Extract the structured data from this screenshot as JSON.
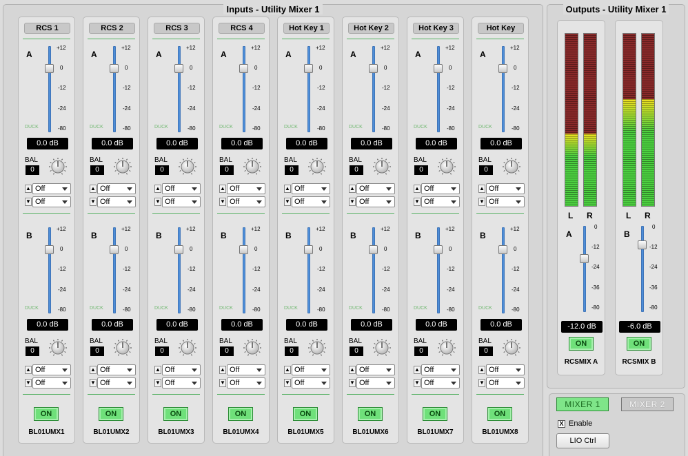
{
  "inputs_title": "Inputs - Utility Mixer 1",
  "outputs_title": "Outputs - Utility Mixer 1",
  "fader_ticks": [
    "+12",
    "0",
    "-12",
    "-24",
    "-80"
  ],
  "output_ticks": [
    "0",
    "-12",
    "-24",
    "-36",
    "-80"
  ],
  "duck_label": "DUCK",
  "bal_label": "BAL",
  "on_label": "ON",
  "strips": [
    {
      "label": "RCS 1",
      "name": "BL01UMX1",
      "a_db": "0.0 dB",
      "a_bal": "0",
      "up": "Off",
      "down": "Off",
      "b_db": "0.0 dB",
      "b_bal": "0",
      "b_up": "Off",
      "b_down": "Off"
    },
    {
      "label": "RCS 2",
      "name": "BL01UMX2",
      "a_db": "0.0 dB",
      "a_bal": "0",
      "up": "Off",
      "down": "Off",
      "b_db": "0.0 dB",
      "b_bal": "0",
      "b_up": "Off",
      "b_down": "Off"
    },
    {
      "label": "RCS 3",
      "name": "BL01UMX3",
      "a_db": "0.0 dB",
      "a_bal": "0",
      "up": "Off",
      "down": "Off",
      "b_db": "0.0 dB",
      "b_bal": "0",
      "b_up": "Off",
      "b_down": "Off"
    },
    {
      "label": "RCS 4",
      "name": "BL01UMX4",
      "a_db": "0.0 dB",
      "a_bal": "0",
      "up": "Off",
      "down": "Off",
      "b_db": "0.0 dB",
      "b_bal": "0",
      "b_up": "Off",
      "b_down": "Off"
    },
    {
      "label": "Hot Key 1",
      "name": "BL01UMX5",
      "a_db": "0.0 dB",
      "a_bal": "0",
      "up": "Off",
      "down": "Off",
      "b_db": "0.0 dB",
      "b_bal": "0",
      "b_up": "Off",
      "b_down": "Off"
    },
    {
      "label": "Hot Key 2",
      "name": "BL01UMX6",
      "a_db": "0.0 dB",
      "a_bal": "0",
      "up": "Off",
      "down": "Off",
      "b_db": "0.0 dB",
      "b_bal": "0",
      "b_up": "Off",
      "b_down": "Off"
    },
    {
      "label": "Hot Key 3",
      "name": "BL01UMX7",
      "a_db": "0.0 dB",
      "a_bal": "0",
      "up": "Off",
      "down": "Off",
      "b_db": "0.0 dB",
      "b_bal": "0",
      "b_up": "Off",
      "b_down": "Off"
    },
    {
      "label": "Hot Key",
      "name": "BL01UMX8",
      "a_db": "0.0 dB",
      "a_bal": "0",
      "up": "Off",
      "down": "Off",
      "b_db": "0.0 dB",
      "b_bal": "0",
      "b_up": "Off",
      "b_down": "Off"
    }
  ],
  "outputs": [
    {
      "bus": "A",
      "name": "RCSMIX A",
      "db": "-12.0 dB",
      "level_db": -12,
      "meter_fill": 0.42,
      "left": "L",
      "right": "R"
    },
    {
      "bus": "B",
      "name": "RCSMIX B",
      "db": "-6.0 dB",
      "level_db": -6,
      "meter_fill": 0.62,
      "left": "L",
      "right": "R"
    }
  ],
  "mixer1_label": "MIXER 1",
  "mixer2_label": "MIXER 2",
  "enable_label": "Enable",
  "enable_checked": "X",
  "lio_label": "LIO Ctrl",
  "colors": {
    "fader": "#4e8ed8",
    "on_green": "#6fe07a",
    "meter_green": "#4cd040",
    "meter_yellow": "#f0e020",
    "meter_red": "#8a2a2a"
  }
}
